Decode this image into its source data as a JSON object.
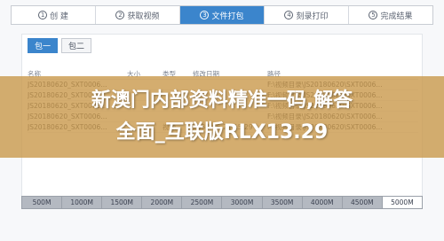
{
  "steps": [
    {
      "num": "1",
      "label": "创 建",
      "active": false
    },
    {
      "num": "2",
      "label": "获取视频",
      "active": false
    },
    {
      "num": "3",
      "label": "文件打包",
      "active": true
    },
    {
      "num": "4",
      "label": "刻录打印",
      "active": false
    },
    {
      "num": "5",
      "label": "完成结果",
      "active": false
    }
  ],
  "packages": [
    "包一",
    "包二"
  ],
  "table": {
    "headers": [
      "名称",
      "大小",
      "类型",
      "修改日期",
      "路径"
    ],
    "rows": [
      [
        "JS20180620_SXT0006...",
        "",
        "",
        "",
        "F:\\视频目录\\JS20180620\\SXT0006..."
      ],
      [
        "JS20180620_SXT0006...",
        "",
        "",
        "",
        "F:\\视频目录\\JS20180620\\SXT0006..."
      ],
      [
        "JS20180620_SXT0006...",
        "",
        "",
        "",
        "F:\\视频目录\\JS20180620\\SXT0006..."
      ],
      [
        "JS20180620_SXT0006...",
        "",
        "",
        "",
        "F:\\视频目录\\JS20180620\\SXT0006..."
      ],
      [
        "JS20180620_SXT0006...",
        "",
        "视频",
        "2033-06-21 15:29",
        "F:\\视频目录\\JS20180620\\SXT0006..."
      ]
    ]
  },
  "scale": [
    "500M",
    "1000M",
    "1500M",
    "2000M",
    "2500M",
    "3000M",
    "3500M",
    "4000M",
    "4500M",
    "5000M"
  ],
  "overlay": {
    "line1": "新澳门内部资料精准一码,解答",
    "line2": "全面_互联版RLX13.29"
  }
}
